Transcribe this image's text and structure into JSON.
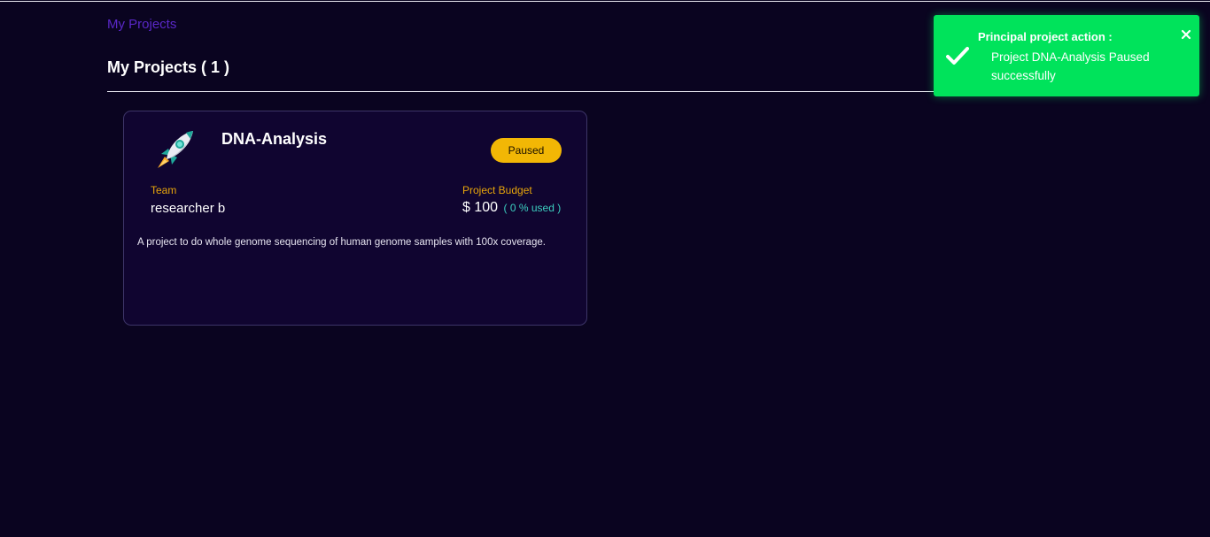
{
  "breadcrumb": {
    "label": "My Projects"
  },
  "page": {
    "title": "My Projects ( 1 )"
  },
  "projects": [
    {
      "icon": "rocket-icon",
      "name": "DNA-Analysis",
      "status": "Paused",
      "team_label": "Team",
      "team": "researcher b",
      "budget_label": "Project Budget",
      "budget": "$ 100",
      "budget_used": "( 0 % used )",
      "description": "A project to do whole genome sequencing of human genome samples with 100x coverage."
    }
  ],
  "toast": {
    "icon": "check-icon",
    "title": "Principal project action :",
    "message": "Project DNA-Analysis Paused successfully",
    "close_icon": "close-icon"
  },
  "colors": {
    "background": "#0a0420",
    "card_background": "#100530",
    "card_border": "#3d3568",
    "breadcrumb": "#5a28c8",
    "status_paused": "#f2b705",
    "label_accent": "#e8a60a",
    "budget_used": "#3ccfc0",
    "toast_success": "#00e35b"
  }
}
